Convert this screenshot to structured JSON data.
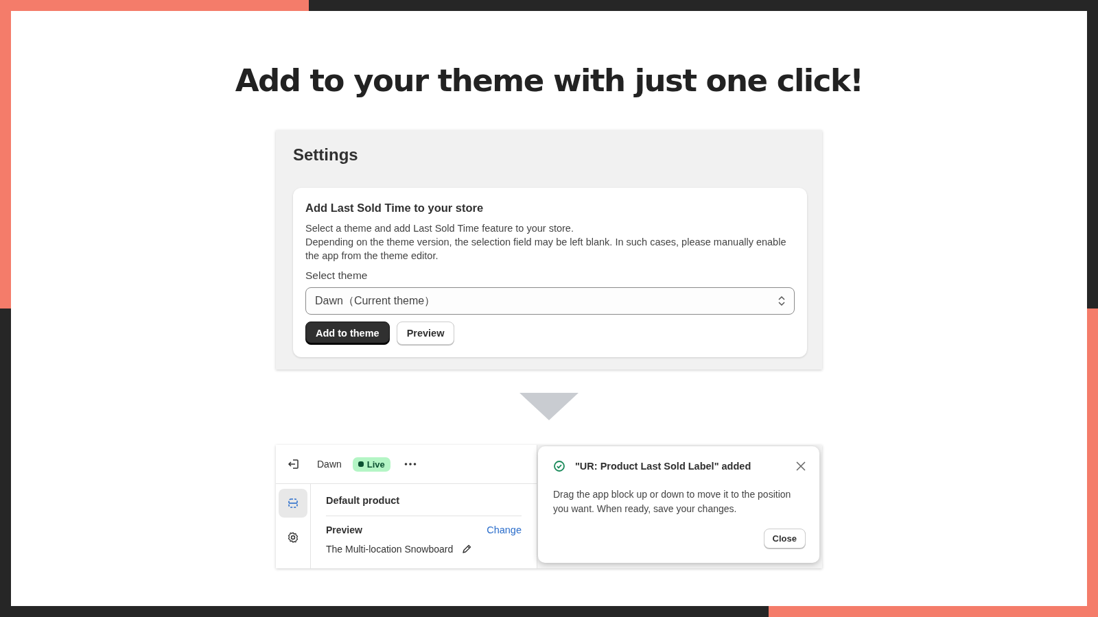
{
  "headline": "Add to your theme with just one click!",
  "settings": {
    "title": "Settings",
    "card": {
      "heading": "Add Last Sold Time to your store",
      "description": [
        "Select a theme and add Last Sold Time feature to your store.",
        "Depending on the theme version, the selection field may be left blank. In such cases, please manually enable the app from the theme editor."
      ],
      "select_label": "Select theme",
      "select_value": "Dawn（Current theme）",
      "buttons": [
        {
          "label": "Add to theme",
          "kind": "primary"
        },
        {
          "label": "Preview",
          "kind": "secondary"
        }
      ]
    }
  },
  "editor": {
    "theme_name": "Dawn",
    "status_badge": "Live",
    "sidebar": [
      {
        "kind": "sections",
        "selected": true
      },
      {
        "kind": "settings",
        "selected": false
      }
    ],
    "section_title": "Default product",
    "preview_label": "Preview",
    "change_link": "Change",
    "preview_product": "The Multi-location Snowboard"
  },
  "toast": {
    "title": "\"UR: Product Last Sold Label\" added",
    "message": "Drag the app block up or down to move it to the position you want. When ready, save your changes.",
    "close_button": "Close"
  }
}
